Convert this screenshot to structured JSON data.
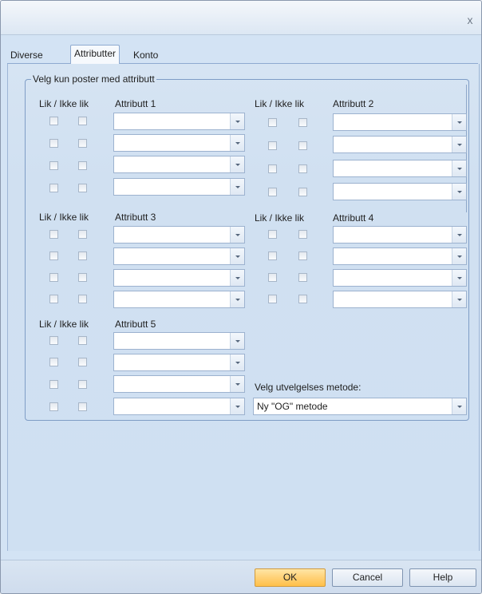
{
  "window": {
    "close_glyph": "x"
  },
  "tabs": [
    {
      "label": "Diverse",
      "active": false
    },
    {
      "label": "Attributter",
      "active": true
    },
    {
      "label": "Konto",
      "active": false
    }
  ],
  "group": {
    "title": "Velg kun poster med attributt",
    "lik_label": "Lik / Ikke lik",
    "attributes": [
      {
        "title": "Attributt 1",
        "rows": [
          "",
          "",
          "",
          ""
        ]
      },
      {
        "title": "Attributt 2",
        "rows": [
          "",
          "",
          "",
          ""
        ]
      },
      {
        "title": "Attributt 3",
        "rows": [
          "",
          "",
          "",
          ""
        ]
      },
      {
        "title": "Attributt 4",
        "rows": [
          "",
          "",
          "",
          ""
        ]
      },
      {
        "title": "Attributt 5",
        "rows": [
          "",
          "",
          "",
          ""
        ]
      }
    ]
  },
  "method": {
    "label": "Velg utvelgelses metode:",
    "value": "Ny \"OG\" metode"
  },
  "buttons": {
    "ok": "OK",
    "cancel": "Cancel",
    "help": "Help"
  },
  "colors": {
    "accent_ok": "#ffc04a",
    "panel": "#d3e3f4",
    "border": "#7f9dc6"
  }
}
